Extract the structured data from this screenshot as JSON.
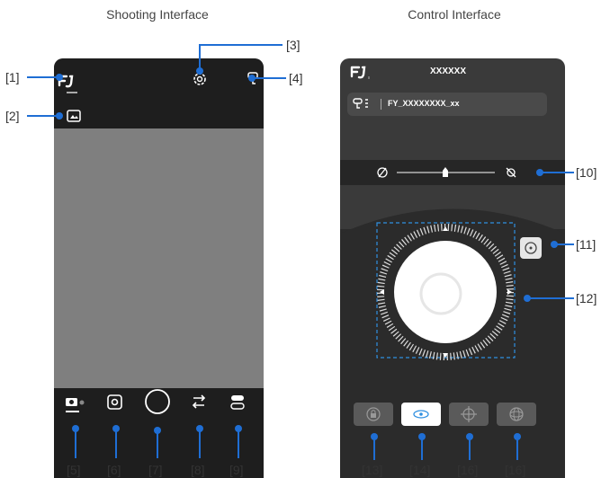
{
  "captions": {
    "shooting": "Shooting Interface",
    "control": "Control Interface"
  },
  "callouts": {
    "c1": "[1]",
    "c2": "[2]",
    "c3": "[3]",
    "c4": "[4]",
    "c5": "[5]",
    "c6": "[6]",
    "c7": "[7]",
    "c8": "[8]",
    "c9": "[9]",
    "c10": "[10]",
    "c11": "[11]",
    "c12": "[12]",
    "c13": "[13]",
    "c14": "[14]",
    "c16a": "[16]",
    "c16b": "[16]"
  },
  "control": {
    "title": "XXXXXX",
    "device_name": "FY_XXXXXXXX_xx"
  },
  "colors": {
    "leader": "#1f6ed4",
    "active_mode": "#ffffff"
  },
  "icons": {
    "logo": "feiyu-logo-icon",
    "gallery": "gallery-icon",
    "settings": "gear-icon",
    "gimbal": "gimbal-icon",
    "photo_mode": "camera-icon",
    "record": "record-icon",
    "shutter": "shutter-button",
    "switch_camera": "switch-camera-icon",
    "toggle": "toggle-icon",
    "slow": "slow-speed-icon",
    "fast": "fast-speed-icon",
    "recenter": "recenter-icon",
    "lock": "lock-mode-icon",
    "follow": "follow-mode-icon",
    "mode16a": "pan-follow-icon",
    "mode16b": "full-follow-icon"
  }
}
